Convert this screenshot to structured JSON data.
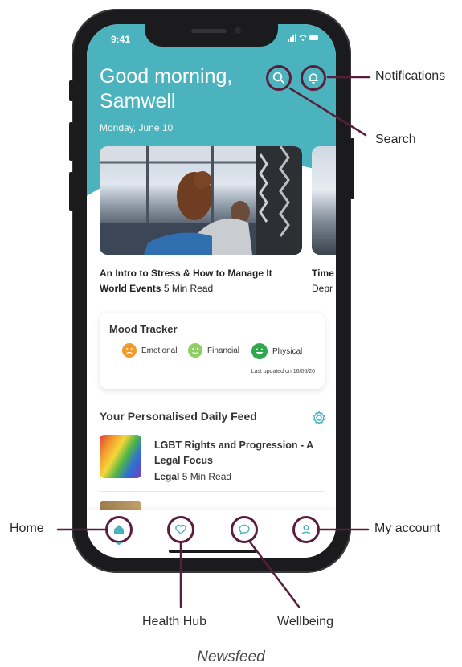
{
  "status_bar": {
    "time": "9:41",
    "icons": "••• ◠ ▬"
  },
  "header": {
    "greeting": "Good morning, Samwell",
    "date": "Monday, June 10",
    "search_icon": "search-icon",
    "notifications_icon": "bell-icon"
  },
  "articles": [
    {
      "title": "An Intro to Stress & How to Manage It",
      "category": "World Events",
      "read_time": "5 Min Read"
    },
    {
      "title": "Time",
      "category": "Depr",
      "read_time": ""
    }
  ],
  "mood_tracker": {
    "title": "Mood Tracker",
    "items": [
      {
        "label": "Emotional",
        "color": "#f29a2e"
      },
      {
        "label": "Financial",
        "color": "#8fcf63"
      },
      {
        "label": "Physical",
        "color": "#2fa84f"
      }
    ],
    "updated": "Last updated on 16/06/20"
  },
  "feed": {
    "title": "Your Personalised Daily Feed",
    "items": [
      {
        "title": "LGBT Rights and Progression - A Legal Focus",
        "category": "Legal",
        "read_time": "5 Min Read"
      }
    ]
  },
  "bottom_nav": [
    {
      "id": "home",
      "icon": "home-icon"
    },
    {
      "id": "health-hub",
      "icon": "heart-icon"
    },
    {
      "id": "wellbeing",
      "icon": "chat-bubble-icon"
    },
    {
      "id": "my-account",
      "icon": "user-icon"
    }
  ],
  "callouts": {
    "notifications": "Notifications",
    "search": "Search",
    "home": "Home",
    "my_account": "My account",
    "health_hub": "Health Hub",
    "wellbeing": "Wellbeing"
  },
  "caption": "Newsfeed",
  "colors": {
    "teal": "#4bb3bd",
    "callout": "#5a1e3c"
  }
}
